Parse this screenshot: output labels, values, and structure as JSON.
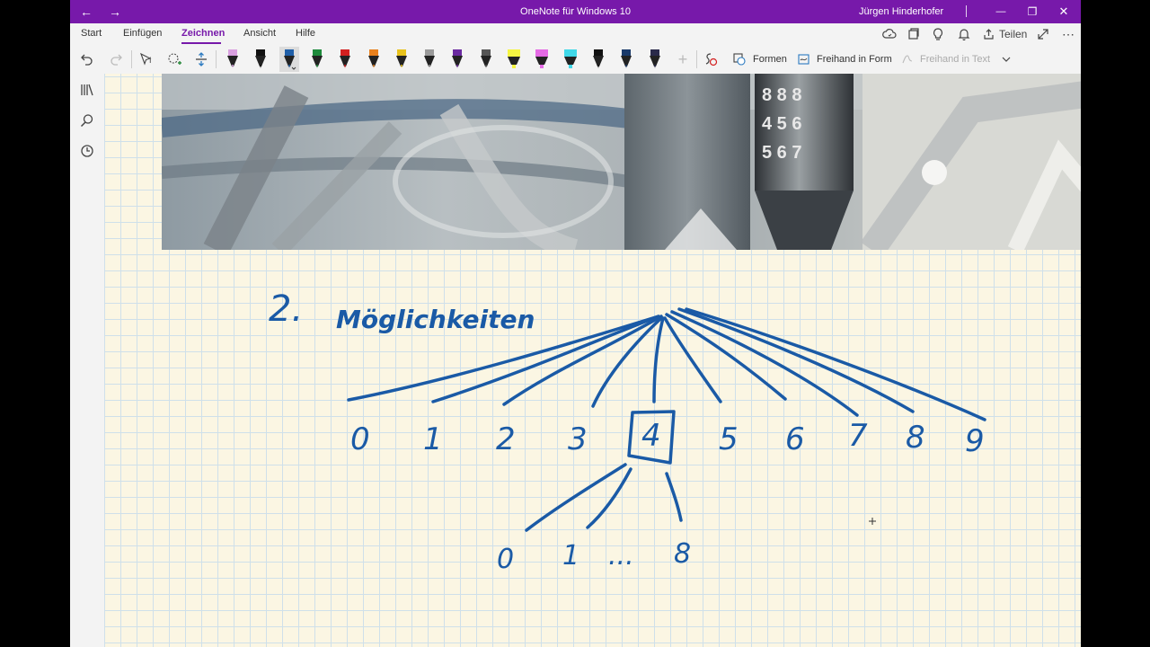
{
  "titlebar": {
    "app_title": "OneNote für Windows 10",
    "user": "Jürgen Hinderhofer",
    "back_glyph": "←",
    "forward_glyph": "→",
    "minimize_glyph": "—",
    "maximize_glyph": "❐",
    "close_glyph": "✕"
  },
  "menu": {
    "tabs": [
      {
        "label": "Start"
      },
      {
        "label": "Einfügen"
      },
      {
        "label": "Zeichnen",
        "active": true
      },
      {
        "label": "Ansicht"
      },
      {
        "label": "Hilfe"
      }
    ],
    "share_label": "Teilen",
    "more_glyph": "⋯"
  },
  "ribbon": {
    "formen_label": "Formen",
    "freihand_form_label": "Freihand in Form",
    "freihand_text_label": "Freihand in Text",
    "pens": [
      {
        "name": "pen-eraser-pink",
        "color": "#d9a0e0"
      },
      {
        "name": "pen-black",
        "color": "#111111"
      },
      {
        "name": "pen-blue-selected",
        "color": "#1f5fa8"
      },
      {
        "name": "pen-green",
        "color": "#1e8a3c"
      },
      {
        "name": "pen-red",
        "color": "#d32020"
      },
      {
        "name": "pen-orange",
        "color": "#e8801c"
      },
      {
        "name": "pen-yellow",
        "color": "#e8c21c"
      },
      {
        "name": "pen-gray",
        "color": "#9a9a9a"
      },
      {
        "name": "pen-purple",
        "color": "#6a2aa0"
      },
      {
        "name": "pen-darkgray",
        "color": "#555555"
      },
      {
        "name": "highlighter-yellow",
        "color": "#f5f542"
      },
      {
        "name": "highlighter-magenta",
        "color": "#e46ae4"
      },
      {
        "name": "highlighter-cyan",
        "color": "#40d8e8"
      },
      {
        "name": "pen-black-2",
        "color": "#111111"
      },
      {
        "name": "pen-galaxy-1",
        "color": "#1a3a6a"
      },
      {
        "name": "pen-galaxy-2",
        "color": "#2a2a4a"
      }
    ]
  },
  "colors": {
    "accent": "#7719aa",
    "ink": "#1a5aa6",
    "page_background": "#fbf6e3",
    "grid": "#cfe0ea"
  },
  "page": {
    "ink_text": {
      "heading_number": "2.",
      "heading_word": "Möglichkeiten",
      "top_digits": [
        "0",
        "1",
        "2",
        "3",
        "4",
        "5",
        "6",
        "7",
        "8",
        "9"
      ],
      "boxed_digit": "4",
      "bottom_digits": [
        "0",
        "1",
        "...",
        "8"
      ]
    }
  }
}
